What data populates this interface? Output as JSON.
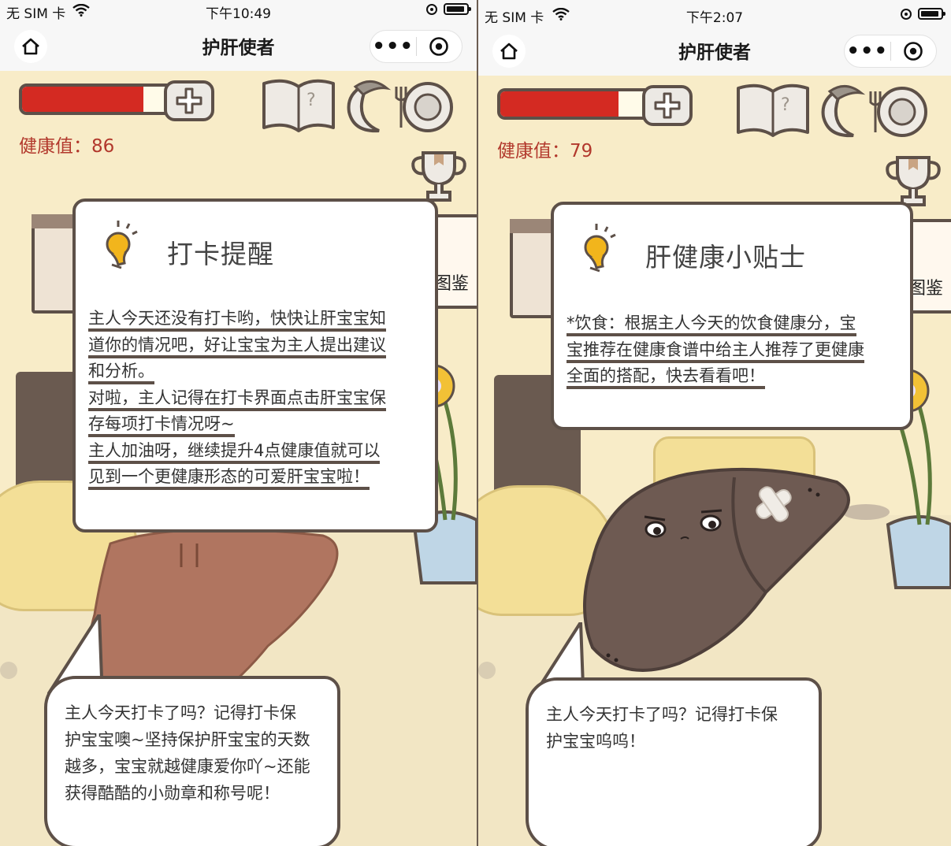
{
  "left": {
    "status": {
      "carrier": "无 SIM 卡",
      "time": "下午10:49"
    },
    "nav": {
      "title": "护肝使者",
      "more": "•••"
    },
    "health": {
      "label": "健康值：86",
      "fill_fraction": 0.8
    },
    "side_label": "图鉴",
    "card": {
      "title": "打卡提醒",
      "lines": [
        "主人今天还没有打卡哟，快快让肝宝宝知",
        "道你的情况吧，好让宝宝为主人提出建议",
        "和分析。",
        "对啦，主人记得在打卡界面点击肝宝宝保",
        "存每项打卡情况呀~",
        "主人加油呀，继续提升4点健康值就可以",
        "见到一个更健康形态的可爱肝宝宝啦！"
      ]
    },
    "bubble": {
      "lines": [
        "主人今天打卡了吗？记得打卡保",
        "护宝宝噢~坚持保护肝宝宝的天数",
        "越多，宝宝就越健康爱你吖~还能",
        "获得酷酷的小勋章和称号呢！"
      ]
    }
  },
  "right": {
    "status": {
      "carrier": "无 SIM 卡",
      "time": "下午2:07"
    },
    "nav": {
      "title": "护肝使者",
      "more": "•••"
    },
    "health": {
      "label": "健康值：79",
      "fill_fraction": 0.78
    },
    "side_label": "图鉴",
    "card": {
      "title": "肝健康小贴士",
      "lines": [
        "*饮食：根据主人今天的饮食健康分，宝",
        "宝推荐在健康食谱中给主人推荐了更健康",
        "全面的搭配，快去看看吧！"
      ]
    },
    "bubble": {
      "lines": [
        "主人今天打卡了吗？记得打卡保",
        "护宝宝呜呜！"
      ]
    }
  },
  "colors": {
    "health_red": "#d42a22",
    "outline": "#5d5048",
    "background": "#f8ecc8"
  },
  "icons": [
    "home-icon",
    "more-dots-icon",
    "target-icon",
    "plus-icon",
    "book-icon",
    "moon-sleep-icon",
    "plate-fork-icon",
    "trophy-icon",
    "lightbulb-icon",
    "wifi-icon",
    "battery-icon"
  ]
}
